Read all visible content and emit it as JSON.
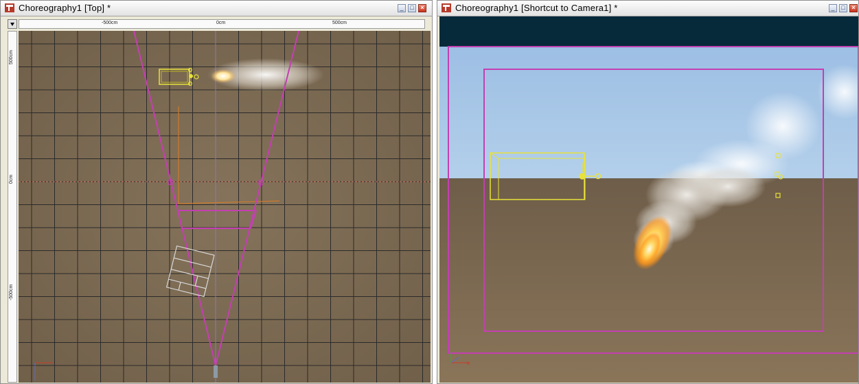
{
  "left_window": {
    "title": "Choreography1 [Top] *",
    "ruler": {
      "top_labels": [
        "-500cm",
        "0cm",
        "500cm"
      ],
      "left_labels": [
        "500cm",
        "0cm",
        "-500cm"
      ]
    }
  },
  "right_window": {
    "title": "Choreography1 [Shortcut to Camera1] *"
  },
  "colors": {
    "ground": "#7c6a52",
    "grid_line": "#2a2a2a",
    "frustum": "#c43fb2",
    "light_gizmo": "#e8e23a",
    "sky": "#a9c8e6",
    "sky_top": "#062a3a",
    "axis_red": "#c83a2a"
  }
}
